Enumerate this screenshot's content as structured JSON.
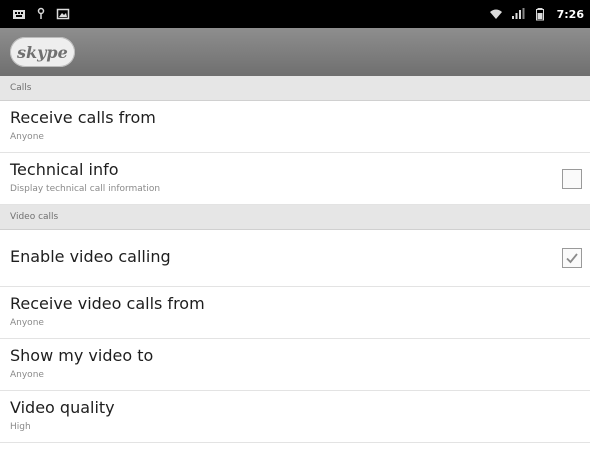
{
  "status_bar": {
    "icons_left": [
      "keyboard-icon",
      "usb-icon",
      "image-icon"
    ],
    "icons_right": [
      "wifi-icon",
      "signal-icon",
      "battery-icon"
    ],
    "time": "7:26"
  },
  "app_bar": {
    "logo_text": "skype"
  },
  "sections": [
    {
      "header": "Calls",
      "items": [
        {
          "title": "Receive calls from",
          "summary": "Anyone"
        },
        {
          "title": "Technical info",
          "summary": "Display technical call information",
          "checked": false
        }
      ]
    },
    {
      "header": "Video calls",
      "items": [
        {
          "title": "Enable video calling",
          "checked": true
        },
        {
          "title": "Receive video calls from",
          "summary": "Anyone"
        },
        {
          "title": "Show my video to",
          "summary": "Anyone"
        },
        {
          "title": "Video quality",
          "summary": "High"
        }
      ]
    }
  ],
  "colors": {
    "status_bar_bg": "#000000",
    "app_bar_bg": "#7f7f7f",
    "section_header_bg": "#e6e6e6",
    "check_mark": "#8a8a8a"
  }
}
